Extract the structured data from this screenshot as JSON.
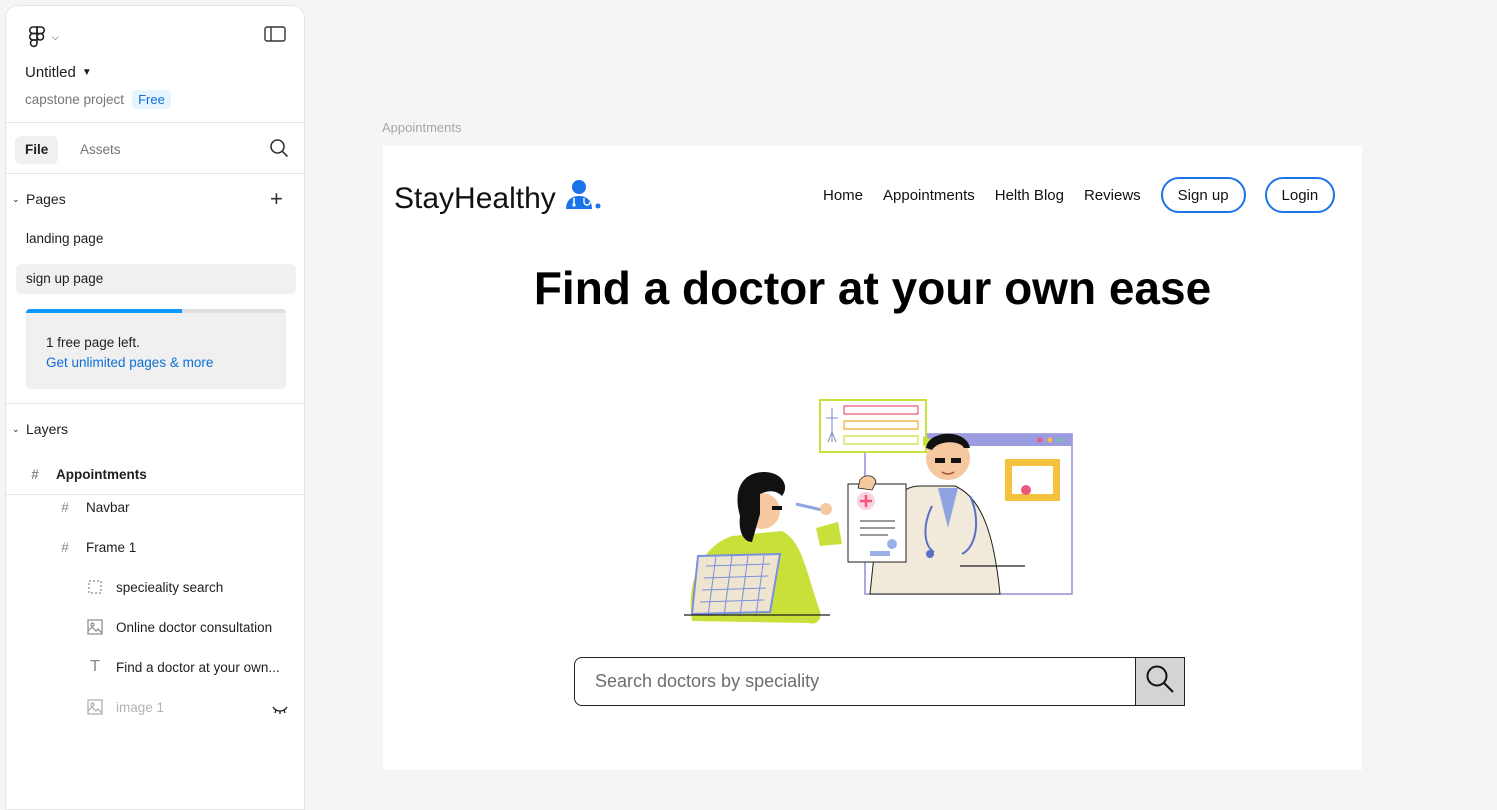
{
  "sidebar": {
    "file_title": "Untitled",
    "project_name": "capstone project",
    "plan_badge": "Free",
    "tabs": [
      {
        "label": "File",
        "active": true
      },
      {
        "label": "Assets",
        "active": false
      }
    ],
    "pages_header": "Pages",
    "pages": [
      {
        "label": "landing page",
        "selected": false
      },
      {
        "label": "sign up page",
        "selected": true
      }
    ],
    "page_limit": {
      "used_fraction": 0.6,
      "text": "1 free page left.",
      "link": "Get unlimited pages & more"
    },
    "layers_header": "Layers",
    "layers": [
      {
        "label": "Appointments",
        "icon": "frame-icon"
      },
      {
        "label": "Navbar",
        "icon": "frame-icon"
      },
      {
        "label": "Frame 1",
        "icon": "frame-icon"
      },
      {
        "label": "specieality search",
        "icon": "dashed-frame-icon"
      },
      {
        "label": "Online doctor consultation",
        "icon": "image-icon"
      },
      {
        "label": "Find a doctor at your own...",
        "icon": "text-icon"
      },
      {
        "label": "image 1",
        "icon": "image-icon",
        "hidden": true
      }
    ]
  },
  "canvas": {
    "frame_label": "Appointments",
    "brand": "StayHealthy",
    "nav_links": [
      "Home",
      "Appointments",
      "Helth Blog",
      "Reviews"
    ],
    "signup_label": "Sign up",
    "login_label": "Login",
    "hero_title": "Find a doctor at your own ease",
    "search_placeholder": "Search doctors by speciality",
    "accent_color": "#1a73e8"
  }
}
